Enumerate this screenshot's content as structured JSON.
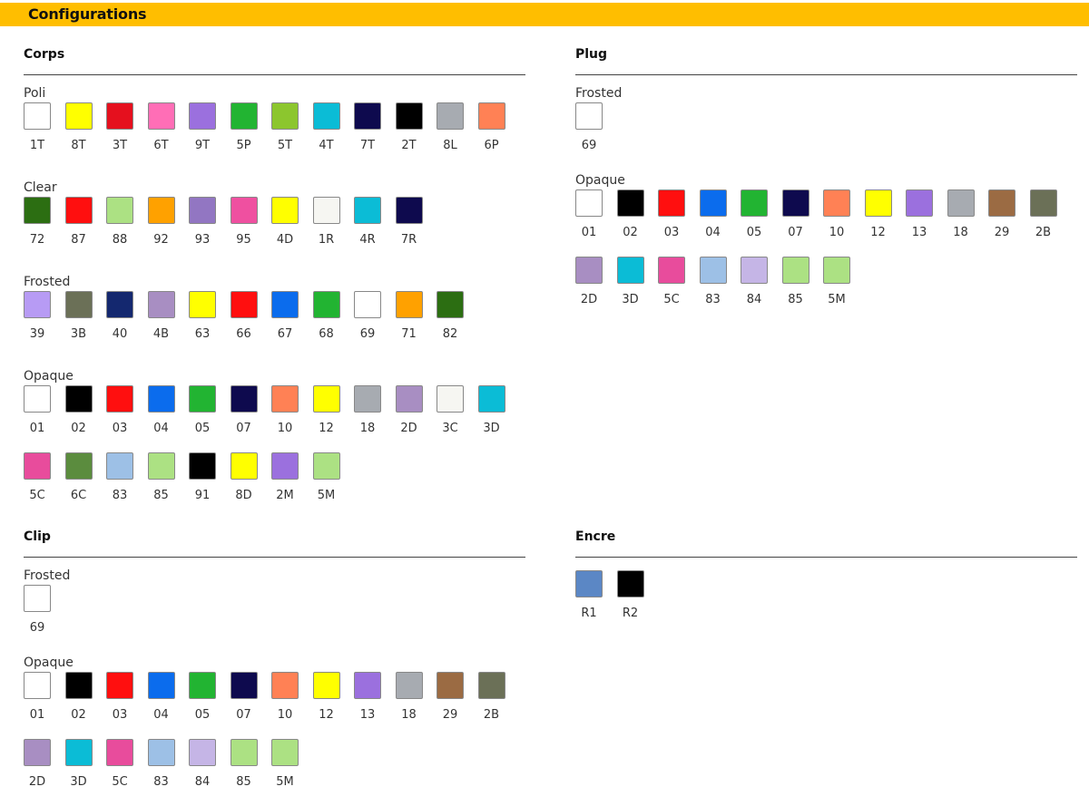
{
  "header": {
    "title": "Configurations",
    "color": "#ffbe00"
  },
  "sections": {
    "corps": {
      "title": "Corps",
      "groups": [
        {
          "label": "Poli",
          "swatches": [
            {
              "code": "1T",
              "color": "#ffffff"
            },
            {
              "code": "8T",
              "color": "#ffff00"
            },
            {
              "code": "3T",
              "color": "#e5101e"
            },
            {
              "code": "6T",
              "color": "#ff6eb6"
            },
            {
              "code": "9T",
              "color": "#9b70de"
            },
            {
              "code": "5P",
              "color": "#22b432"
            },
            {
              "code": "5T",
              "color": "#8cc62e"
            },
            {
              "code": "4T",
              "color": "#0bbcd6"
            },
            {
              "code": "7T",
              "color": "#0e0a4e"
            },
            {
              "code": "2T",
              "color": "#000000"
            },
            {
              "code": "8L",
              "color": "#a7abb1"
            },
            {
              "code": "6P",
              "color": "#ff8155"
            }
          ]
        },
        {
          "label": "Clear",
          "swatches": [
            {
              "code": "72",
              "color": "#2c6e12"
            },
            {
              "code": "87",
              "color": "#ff0f0f"
            },
            {
              "code": "88",
              "color": "#ace183"
            },
            {
              "code": "92",
              "color": "#ffa100"
            },
            {
              "code": "93",
              "color": "#9276c2"
            },
            {
              "code": "95",
              "color": "#ef50a0"
            },
            {
              "code": "4D",
              "color": "#ffff00"
            },
            {
              "code": "1R",
              "color": "#f6f6f2"
            },
            {
              "code": "4R",
              "color": "#0bbcd6"
            },
            {
              "code": "7R",
              "color": "#0e0a4e"
            }
          ]
        },
        {
          "label": "Frosted",
          "swatches": [
            {
              "code": "39",
              "color": "#b79bf4"
            },
            {
              "code": "3B",
              "color": "#6b7057"
            },
            {
              "code": "40",
              "color": "#14286f"
            },
            {
              "code": "4B",
              "color": "#a88ec2"
            },
            {
              "code": "63",
              "color": "#ffff00"
            },
            {
              "code": "66",
              "color": "#ff0f0f"
            },
            {
              "code": "67",
              "color": "#0b6ced"
            },
            {
              "code": "68",
              "color": "#22b432"
            },
            {
              "code": "69",
              "color": "#ffffff"
            },
            {
              "code": "71",
              "color": "#ffa100"
            },
            {
              "code": "82",
              "color": "#2c6e12"
            }
          ]
        },
        {
          "label": "Opaque",
          "swatches": [
            {
              "code": "01",
              "color": "#ffffff"
            },
            {
              "code": "02",
              "color": "#000000"
            },
            {
              "code": "03",
              "color": "#ff0f0f"
            },
            {
              "code": "04",
              "color": "#0b6ced"
            },
            {
              "code": "05",
              "color": "#22b432"
            },
            {
              "code": "07",
              "color": "#0e0a4e"
            },
            {
              "code": "10",
              "color": "#ff8155"
            },
            {
              "code": "12",
              "color": "#ffff00"
            },
            {
              "code": "18",
              "color": "#a7abb1"
            },
            {
              "code": "2D",
              "color": "#a88ec2"
            },
            {
              "code": "3C",
              "color": "#f6f6f2"
            },
            {
              "code": "3D",
              "color": "#0bbcd6"
            },
            {
              "code": "5C",
              "color": "#e84c9c"
            },
            {
              "code": "6C",
              "color": "#5b8c3e"
            },
            {
              "code": "83",
              "color": "#9dc0e6"
            },
            {
              "code": "85",
              "color": "#ace183"
            },
            {
              "code": "91",
              "color": "#000000"
            },
            {
              "code": "8D",
              "color": "#ffff00"
            },
            {
              "code": "2M",
              "color": "#9b70de"
            },
            {
              "code": "5M",
              "color": "#ace183"
            }
          ]
        }
      ]
    },
    "plug": {
      "title": "Plug",
      "groups": [
        {
          "label": "Frosted",
          "swatches": [
            {
              "code": "69",
              "color": "#ffffff"
            }
          ]
        },
        {
          "label": "Opaque",
          "swatches": [
            {
              "code": "01",
              "color": "#ffffff"
            },
            {
              "code": "02",
              "color": "#000000"
            },
            {
              "code": "03",
              "color": "#ff0f0f"
            },
            {
              "code": "04",
              "color": "#0b6ced"
            },
            {
              "code": "05",
              "color": "#22b432"
            },
            {
              "code": "07",
              "color": "#0e0a4e"
            },
            {
              "code": "10",
              "color": "#ff8155"
            },
            {
              "code": "12",
              "color": "#ffff00"
            },
            {
              "code": "13",
              "color": "#9b70de"
            },
            {
              "code": "18",
              "color": "#a7abb1"
            },
            {
              "code": "29",
              "color": "#9b6b43"
            },
            {
              "code": "2B",
              "color": "#6b7057"
            },
            {
              "code": "2D",
              "color": "#a88ec2"
            },
            {
              "code": "3D",
              "color": "#0bbcd6"
            },
            {
              "code": "5C",
              "color": "#e84c9c"
            },
            {
              "code": "83",
              "color": "#9dc0e6"
            },
            {
              "code": "84",
              "color": "#c5b5e6"
            },
            {
              "code": "85",
              "color": "#ace183"
            },
            {
              "code": "5M",
              "color": "#ace183"
            }
          ]
        }
      ]
    },
    "clip": {
      "title": "Clip",
      "groups": [
        {
          "label": "Frosted",
          "swatches": [
            {
              "code": "69",
              "color": "#ffffff"
            }
          ]
        },
        {
          "label": "Opaque",
          "swatches": [
            {
              "code": "01",
              "color": "#ffffff"
            },
            {
              "code": "02",
              "color": "#000000"
            },
            {
              "code": "03",
              "color": "#ff0f0f"
            },
            {
              "code": "04",
              "color": "#0b6ced"
            },
            {
              "code": "05",
              "color": "#22b432"
            },
            {
              "code": "07",
              "color": "#0e0a4e"
            },
            {
              "code": "10",
              "color": "#ff8155"
            },
            {
              "code": "12",
              "color": "#ffff00"
            },
            {
              "code": "13",
              "color": "#9b70de"
            },
            {
              "code": "18",
              "color": "#a7abb1"
            },
            {
              "code": "29",
              "color": "#9b6b43"
            },
            {
              "code": "2B",
              "color": "#6b7057"
            },
            {
              "code": "2D",
              "color": "#a88ec2"
            },
            {
              "code": "3D",
              "color": "#0bbcd6"
            },
            {
              "code": "5C",
              "color": "#e84c9c"
            },
            {
              "code": "83",
              "color": "#9dc0e6"
            },
            {
              "code": "84",
              "color": "#c5b5e6"
            },
            {
              "code": "85",
              "color": "#ace183"
            },
            {
              "code": "5M",
              "color": "#ace183"
            }
          ]
        }
      ]
    },
    "encre": {
      "title": "Encre",
      "groups": [
        {
          "label": "",
          "swatches": [
            {
              "code": "R1",
              "color": "#5b87c5"
            },
            {
              "code": "R2",
              "color": "#000000"
            }
          ]
        }
      ]
    }
  }
}
